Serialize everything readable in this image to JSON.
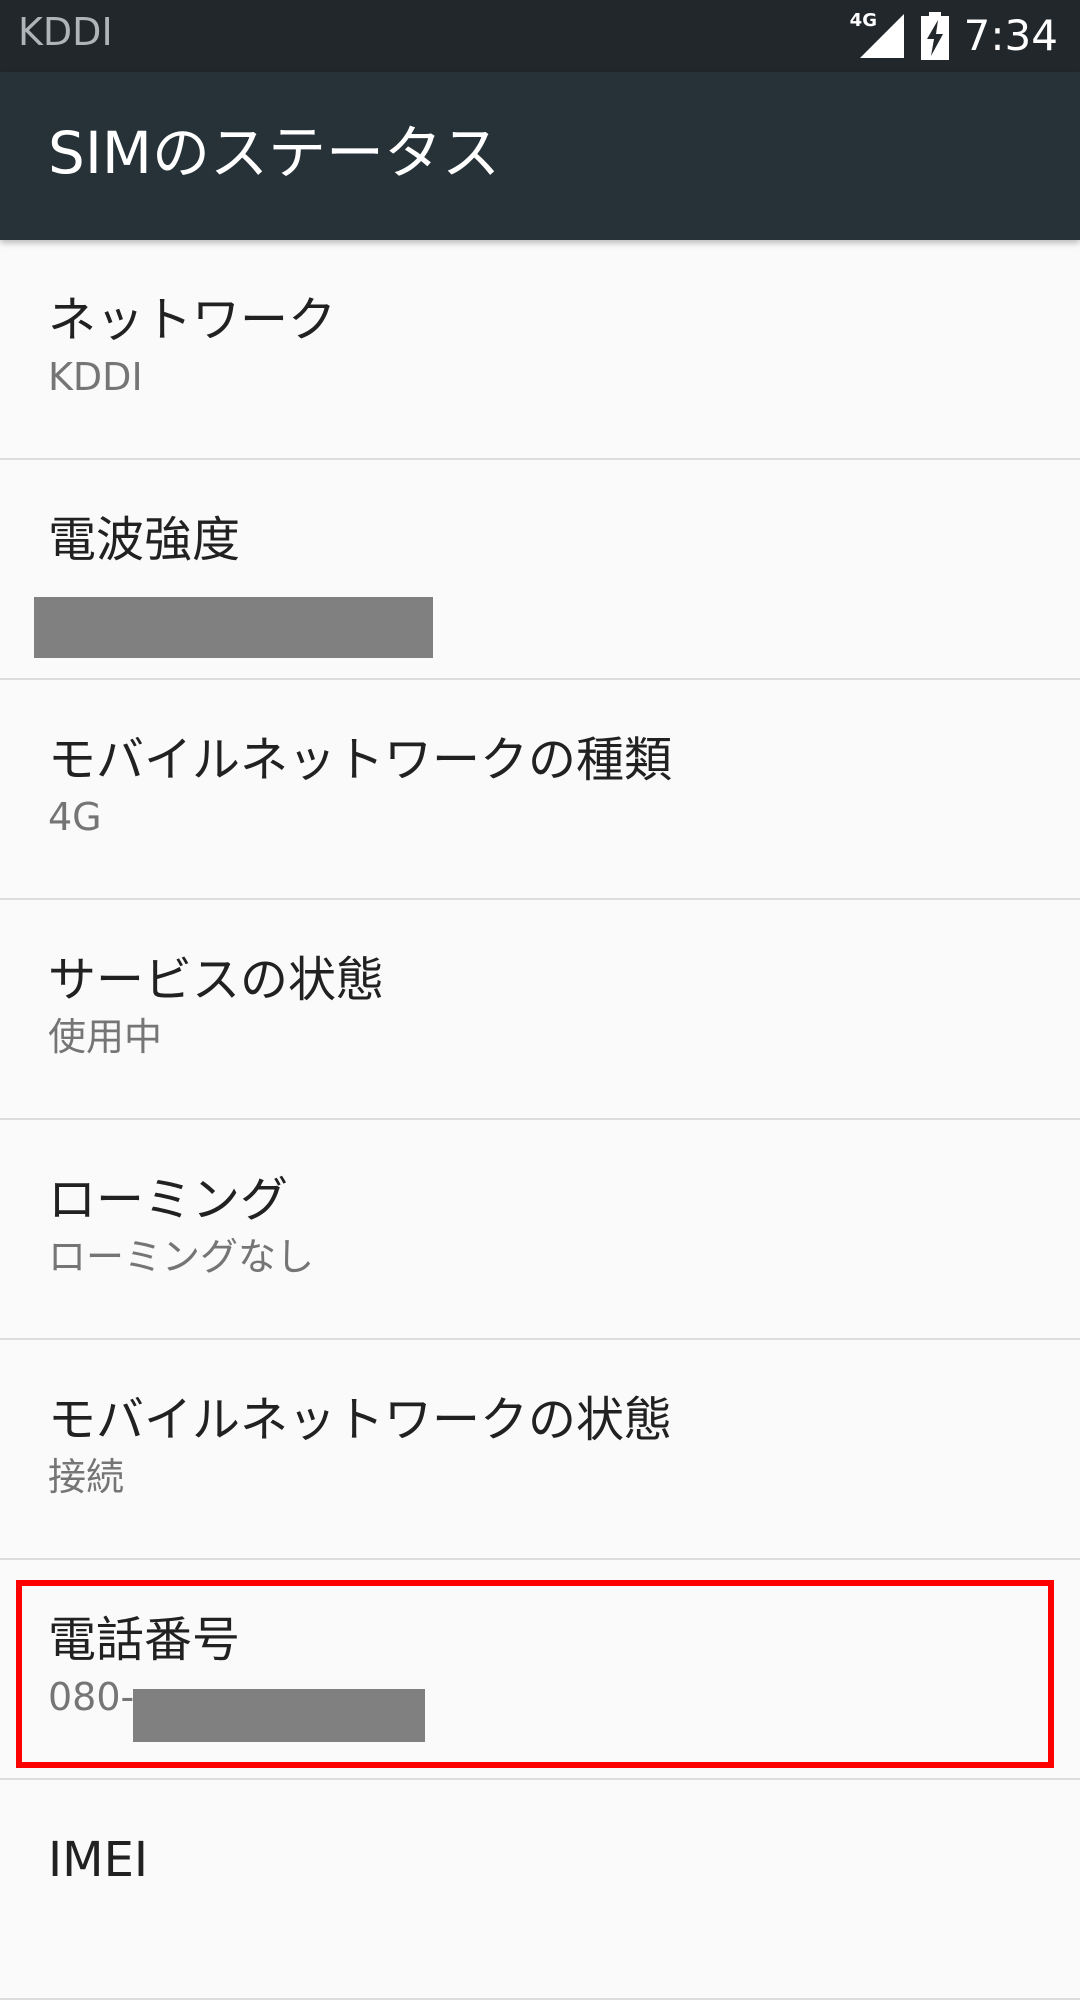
{
  "status_bar": {
    "carrier": "KDDI",
    "network_type": "4G",
    "time": "7:34"
  },
  "app_bar": {
    "title": "SIMのステータス"
  },
  "items": [
    {
      "title": "ネットワーク",
      "summary": "KDDI"
    },
    {
      "title": "電波強度",
      "summary": ""
    },
    {
      "title": "モバイルネットワークの種類",
      "summary": "4G"
    },
    {
      "title": "サービスの状態",
      "summary": "使用中"
    },
    {
      "title": "ローミング",
      "summary": "ローミングなし"
    },
    {
      "title": "モバイルネットワークの状態",
      "summary": "接続"
    },
    {
      "title": "電話番号",
      "summary": "080-"
    },
    {
      "title": "IMEI",
      "summary": ""
    }
  ],
  "colors": {
    "status_bar_bg": "#21272b",
    "app_bar_bg": "#263238",
    "highlight": "#ff0000",
    "redaction": "#808080"
  }
}
